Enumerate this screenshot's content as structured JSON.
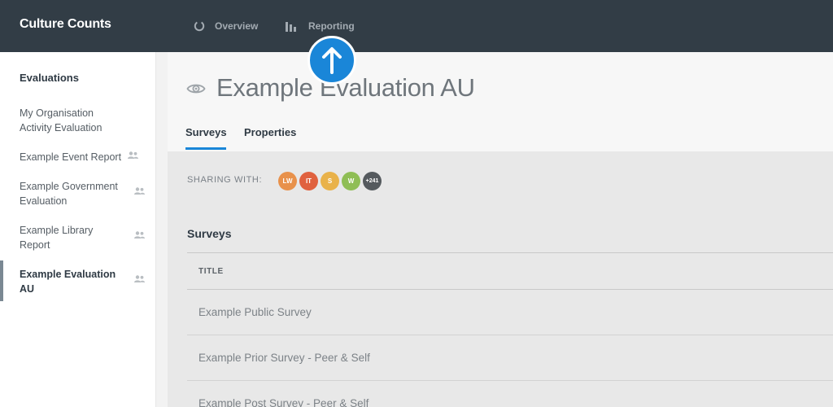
{
  "app": {
    "brand": "Culture Counts"
  },
  "nav": [
    {
      "label": "Overview",
      "icon": "spinner-icon"
    },
    {
      "label": "Reporting",
      "icon": "bar-chart-icon"
    }
  ],
  "overlay": {
    "icon": "up-arrow-icon",
    "color": "#1a86d8"
  },
  "sidebar": {
    "heading": "Evaluations",
    "items": [
      {
        "label": "My Organisation Activity Evaluation",
        "shared": false,
        "active": false
      },
      {
        "label": "Example Event Report",
        "shared": true,
        "active": false
      },
      {
        "label": "Example Government Evaluation",
        "shared": true,
        "active": false
      },
      {
        "label": "Example Library Report",
        "shared": true,
        "active": false
      },
      {
        "label": "Example Evaluation AU",
        "shared": true,
        "active": true
      }
    ]
  },
  "page": {
    "title": "Example Evaluation AU",
    "title_icon": "eye-icon",
    "tabs": [
      {
        "label": "Surveys",
        "active": true
      },
      {
        "label": "Properties",
        "active": false
      }
    ]
  },
  "sharing": {
    "label": "SHARING WITH:",
    "avatars": [
      {
        "initials": "LW",
        "color": "#e8914b"
      },
      {
        "initials": "IT",
        "color": "#e0613f"
      },
      {
        "initials": "S",
        "color": "#e9b24a"
      },
      {
        "initials": "W",
        "color": "#8fbe55"
      },
      {
        "initials": "+241",
        "color": "#555a5e"
      }
    ]
  },
  "surveys": {
    "title": "Surveys",
    "column_header": "TITLE",
    "rows": [
      "Example Public Survey",
      "Example Prior Survey - Peer & Self",
      "Example Post Survey - Peer & Self"
    ]
  }
}
